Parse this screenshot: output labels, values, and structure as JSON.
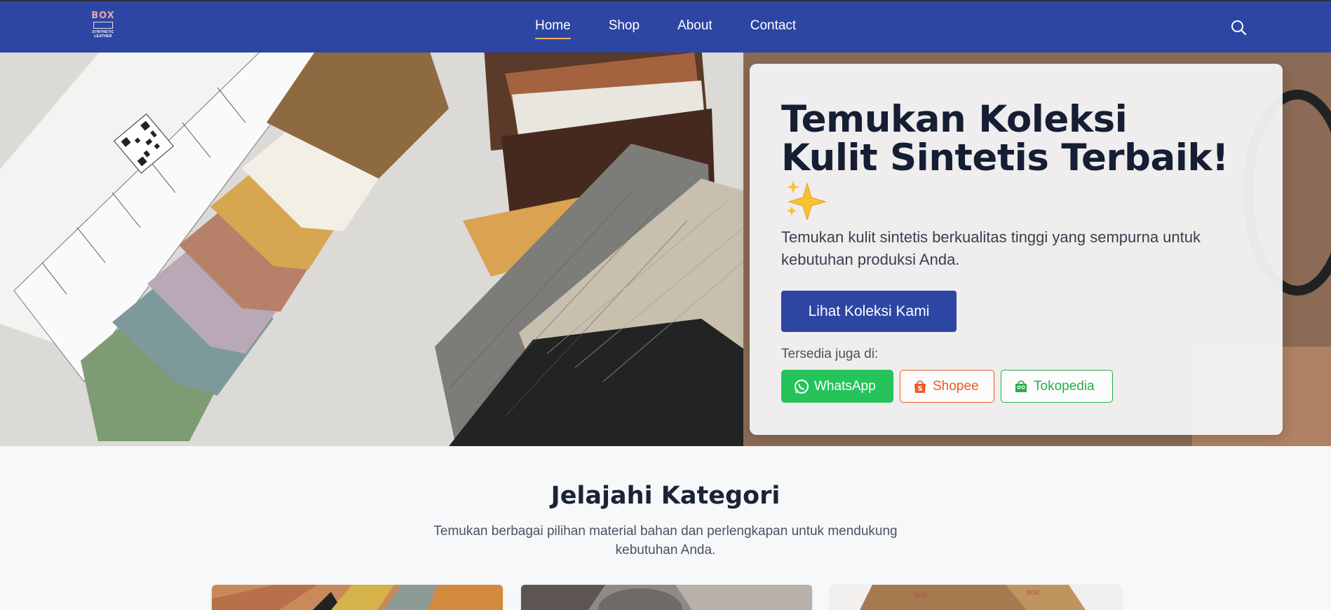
{
  "nav": {
    "logo": {
      "word": "BOX",
      "tag_line1": "SYNTHETIC",
      "tag_line2": "LEATHER"
    },
    "links": [
      "Home",
      "Shop",
      "About",
      "Contact"
    ],
    "active_link": "Home",
    "search_icon": "search-icon"
  },
  "hero": {
    "title_line1": "Temukan Koleksi",
    "title_line2": "Kulit Sintetis Terbaik!",
    "emoji_icon": "sparkles-icon",
    "subtitle": "Temukan kulit sintetis berkualitas tinggi yang sempurna untuk kebutuhan produksi Anda.",
    "cta_label": "Lihat Koleksi Kami",
    "available_label": "Tersedia juga di:",
    "stores": [
      {
        "label": "WhatsApp",
        "icon": "whatsapp-icon"
      },
      {
        "label": "Shopee",
        "icon": "shopee-bag-icon"
      },
      {
        "label": "Tokopedia",
        "icon": "tokopedia-icon"
      }
    ]
  },
  "category": {
    "title": "Jelajahi Kategori",
    "subtitle": "Temukan berbagai pilihan material bahan dan perlengkapan untuk mendukung kebutuhan Anda."
  },
  "colors": {
    "brand_blue": "#2d46a4",
    "nav_active_underline": "#e9b45d",
    "whatsapp_green": "#25c35a",
    "shopee_orange": "#ee5a24",
    "tokopedia_green": "#23b14a"
  }
}
